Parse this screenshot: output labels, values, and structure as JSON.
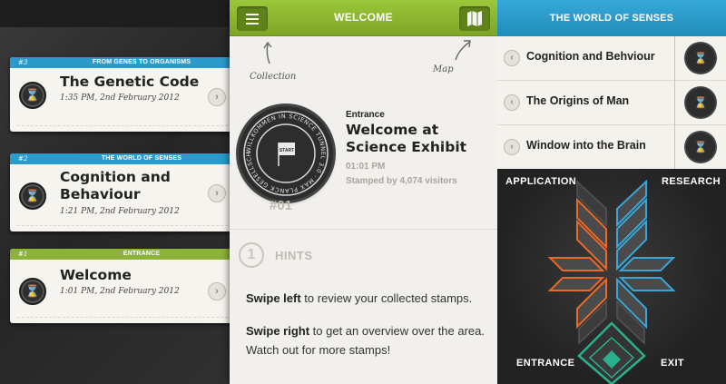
{
  "left_panel": {
    "cards": [
      {
        "number": "#3",
        "band_label": "FROM GENES TO ORGANISMS",
        "band_color": "#2a9bcb",
        "title": "The Genetic Code",
        "time": "1:35 PM, 2nd February 2012"
      },
      {
        "number": "#2",
        "band_label": "THE WORLD OF SENSES",
        "band_color": "#2a9bcb",
        "title": "Cognition and Behaviour",
        "time": "1:21 PM, 2nd February 2012"
      },
      {
        "number": "#1",
        "band_label": "ENTRANCE",
        "band_color": "#8cb23a",
        "title": "Welcome",
        "time": "1:01 PM, 2nd February 2012"
      }
    ]
  },
  "center_panel": {
    "header": {
      "title": "WELCOME",
      "color": "#8cb832"
    },
    "hint_labels": {
      "collection": "Collection",
      "map": "Map"
    },
    "stamp": {
      "ring_text": "WILLKOMMEN IN SCIENCE TUNNEL 3.0 · MAX PLANCK GESELLSCHAFT",
      "center_text": "START",
      "number": "#01"
    },
    "entry": {
      "kicker": "Entrance",
      "title": "Welcome at Science Exhibit",
      "time": "01:01 PM",
      "visitors": "Stamped by 4,074 visitors"
    },
    "hints": {
      "number": "1",
      "title": "HINTS",
      "items": [
        {
          "bold": "Swipe left",
          "text": " to review your collected stamps."
        },
        {
          "bold": "Swipe right",
          "text": " to get an overview over the area. Watch out for more stamps!"
        }
      ]
    }
  },
  "right_panel": {
    "header": {
      "title": "THE WORLD OF SENSES",
      "color": "#2a9bcb"
    },
    "items": [
      {
        "label": "Cognition and Behviour"
      },
      {
        "label": "The Origins of Man"
      },
      {
        "label": "Window into the Brain"
      }
    ],
    "map": {
      "labels": {
        "application": "APPLICATION",
        "research": "RESEARCH",
        "entrance": "ENTRANCE",
        "exit": "EXIT"
      },
      "colors": {
        "orange": "#e8692a",
        "blue": "#3aa6d8",
        "teal": "#2ab08c",
        "gray": "#4a4a4a"
      }
    }
  }
}
